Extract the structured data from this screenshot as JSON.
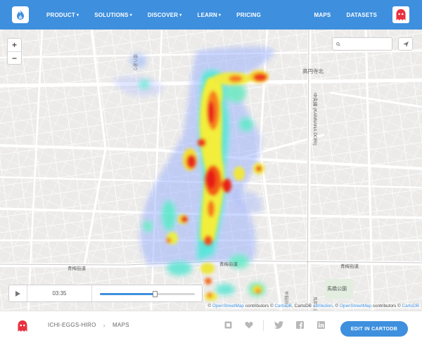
{
  "navbar": {
    "logo_icon": "cartodb-flame-logo",
    "left_items": [
      {
        "label": "PRODUCT",
        "dropdown": true
      },
      {
        "label": "SOLUTIONS",
        "dropdown": true
      },
      {
        "label": "DISCOVER",
        "dropdown": true
      },
      {
        "label": "LEARN",
        "dropdown": true
      },
      {
        "label": "PRICING",
        "dropdown": false
      }
    ],
    "right_items": [
      {
        "label": "MAPS"
      },
      {
        "label": "DATASETS"
      }
    ],
    "avatar_icon": "ghost-avatar",
    "color": "#3e8fde"
  },
  "map": {
    "zoom_in": "+",
    "zoom_out": "−",
    "search": {
      "value": "",
      "placeholder": ""
    },
    "labels": {
      "station": "高円寺北",
      "road_vertical": "中央線 (KANNANA DORI)",
      "road_bottom_1": "青梅街道",
      "road_bottom_2": "青梅街道",
      "road_bottom_3": "青梅街道",
      "park": "馬橋公園",
      "street_1": "環八通り",
      "street_2": "早稲田通",
      "street_3": "馬橋公園"
    }
  },
  "timeslider": {
    "time": "03:35",
    "progress": 0.58
  },
  "attribution": {
    "prefix": "©",
    "osm": "OpenStreetMap",
    "contributors": "contributors ©",
    "cartodb": "CartoDB",
    "cartodb_text": ", CartoDB",
    "attribution_link": "attribution",
    "comma": ", ©",
    "osm2": "OpenStreetMap",
    "contributors2": "contributors ©",
    "cartodb2": "CartoDB"
  },
  "footer": {
    "avatar_icon": "ghost-avatar",
    "user": "ICHI-EGGS-HIRO",
    "section": "MAPS",
    "icons": [
      "embed-icon",
      "heart-icon",
      "twitter-icon",
      "facebook-icon",
      "linkedin-icon"
    ],
    "edit_button": "EDIT IN CARTODB"
  }
}
